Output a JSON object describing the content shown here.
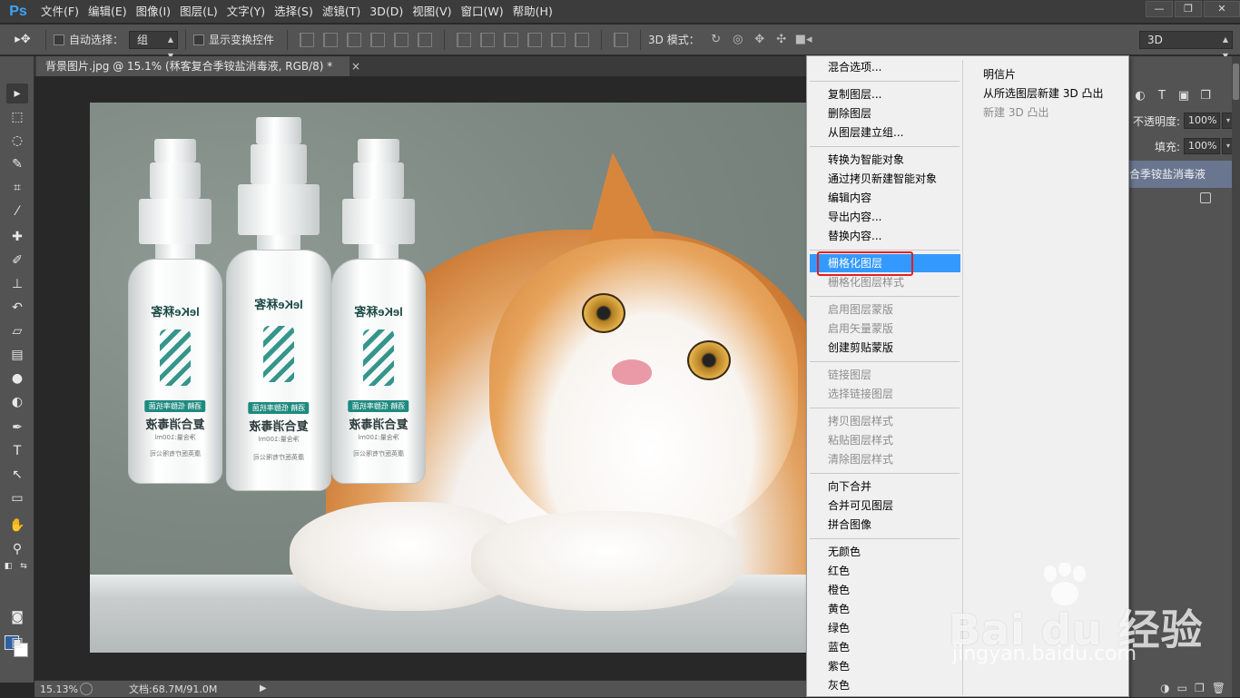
{
  "app": {
    "logo": "Ps"
  },
  "menubar": {
    "items": [
      "文件(F)",
      "编辑(E)",
      "图像(I)",
      "图层(L)",
      "文字(Y)",
      "选择(S)",
      "滤镜(T)",
      "3D(D)",
      "视图(V)",
      "窗口(W)",
      "帮助(H)"
    ],
    "window_controls": [
      "—",
      "❐",
      "✕"
    ]
  },
  "options": {
    "auto_select_label": "自动选择：",
    "auto_select_value": "组",
    "show_transform_label": "显示变换控件",
    "mode_3d_label": "3D 模式：",
    "workspace_value": "3D"
  },
  "document": {
    "tab_title": "背景图片.jpg @ 15.1% (秝客复合季铵盐消毒液, RGB/8) *",
    "tab_close": "×"
  },
  "canvas_image": {
    "bottle_brand": "leKe秝客",
    "bottle_tag": "酒精 低醇率抗菌",
    "bottle_name": "复合消毒液",
    "bottle_volume": "净含量:100ml",
    "bottle_company": "康英医疗有限公司"
  },
  "status": {
    "zoom": "15.13%",
    "doc_size": "文档:68.7M/91.0M"
  },
  "right_panel": {
    "opacity_label": "不透明度:",
    "opacity_value": "100%",
    "fill_label": "填充:",
    "fill_value": "100%",
    "layer_name": "合季铵盐消毒液"
  },
  "context_menu": {
    "left_groups": [
      [
        "混合选项..."
      ],
      [
        "复制图层...",
        "删除图层",
        "从图层建立组..."
      ],
      [
        "转换为智能对象",
        "通过拷贝新建智能对象",
        "编辑内容",
        "导出内容...",
        "替换内容..."
      ],
      [
        "栅格化图层",
        "栅格化图层样式"
      ],
      [
        "启用图层蒙版",
        "启用矢量蒙版",
        "创建剪贴蒙版"
      ],
      [
        "链接图层",
        "选择链接图层"
      ],
      [
        "拷贝图层样式",
        "粘贴图层样式",
        "清除图层样式"
      ],
      [
        "向下合并",
        "合并可见图层",
        "拼合图像"
      ],
      [
        "无颜色",
        "红色",
        "橙色",
        "黄色",
        "绿色",
        "蓝色",
        "紫色",
        "灰色"
      ]
    ],
    "disabled": [
      "栅格化图层样式",
      "启用图层蒙版",
      "启用矢量蒙版",
      "链接图层",
      "选择链接图层",
      "拷贝图层样式",
      "粘贴图层样式",
      "清除图层样式"
    ],
    "highlighted": "栅格化图层",
    "right_items": [
      "明信片",
      "从所选图层新建 3D 凸出",
      "新建 3D 凸出"
    ],
    "right_disabled": [
      "新建 3D 凸出"
    ],
    "highlight_color": "#3399ff",
    "annotation_color": "#e02020"
  },
  "watermark": {
    "brand": "Bai du 经验",
    "url": "jingyan.baidu.com"
  }
}
